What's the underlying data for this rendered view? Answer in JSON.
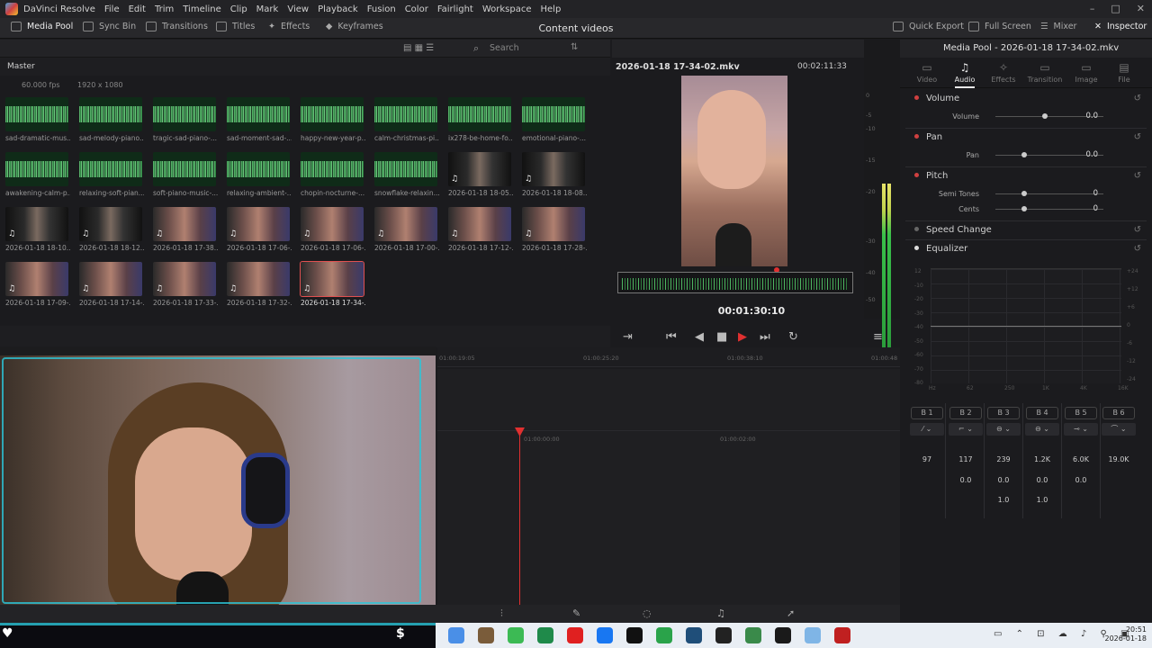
{
  "menubar": {
    "app": "DaVinci Resolve",
    "items": [
      "File",
      "Edit",
      "Trim",
      "Timeline",
      "Clip",
      "Mark",
      "View",
      "Playback",
      "Fusion",
      "Color",
      "Fairlight",
      "Workspace",
      "Help"
    ]
  },
  "toolbar": {
    "media_pool": "Media Pool",
    "sync_bin": "Sync Bin",
    "transitions": "Transitions",
    "titles": "Titles",
    "effects": "Effects",
    "keyframes": "Keyframes",
    "project_title": "Content videos",
    "quick_export": "Quick Export",
    "full_screen": "Full Screen",
    "mixer": "Mixer",
    "inspector": "Inspector"
  },
  "media_pool": {
    "search_placeholder": "Search",
    "bin": "Master",
    "fps": "60.000 fps",
    "resolution": "1920 x 1080",
    "clips": [
      {
        "label": "sad-dramatic-mus...",
        "kind": "audio"
      },
      {
        "label": "sad-melody-piano...",
        "kind": "audio"
      },
      {
        "label": "tragic-sad-piano-...",
        "kind": "audio"
      },
      {
        "label": "sad-moment-sad-...",
        "kind": "audio"
      },
      {
        "label": "happy-new-year-p...",
        "kind": "audio"
      },
      {
        "label": "calm-christmas-pi...",
        "kind": "audio"
      },
      {
        "label": "ix278-be-home-fo...",
        "kind": "audio"
      },
      {
        "label": "emotional-piano-...",
        "kind": "audio"
      },
      {
        "label": "awakening-calm-p...",
        "kind": "audio"
      },
      {
        "label": "relaxing-soft-pian...",
        "kind": "audio"
      },
      {
        "label": "soft-piano-music-...",
        "kind": "audio"
      },
      {
        "label": "relaxing-ambient-...",
        "kind": "audio"
      },
      {
        "label": "chopin-nocturne-...",
        "kind": "audio"
      },
      {
        "label": "snowflake-relaxin...",
        "kind": "audio"
      },
      {
        "label": "2026-01-18 18-05...",
        "kind": "dark"
      },
      {
        "label": "2026-01-18 18-08...",
        "kind": "dark"
      },
      {
        "label": "2026-01-18 18-10...",
        "kind": "dark"
      },
      {
        "label": "2026-01-18 18-12...",
        "kind": "dark"
      },
      {
        "label": "2026-01-18 17-38...",
        "kind": "video"
      },
      {
        "label": "2026-01-18 17-06-...",
        "kind": "video"
      },
      {
        "label": "2026-01-18 17-06-...",
        "kind": "video"
      },
      {
        "label": "2026-01-18 17-00-...",
        "kind": "video"
      },
      {
        "label": "2026-01-18 17-12-...",
        "kind": "video"
      },
      {
        "label": "2026-01-18 17-28-...",
        "kind": "video"
      },
      {
        "label": "2026-01-18 17-09-...",
        "kind": "video"
      },
      {
        "label": "2026-01-18 17-14-...",
        "kind": "video"
      },
      {
        "label": "2026-01-18 17-33-...",
        "kind": "video"
      },
      {
        "label": "2026-01-18 17-32-...",
        "kind": "video"
      },
      {
        "label": "2026-01-18 17-34-...",
        "kind": "video",
        "selected": true
      }
    ]
  },
  "viewer": {
    "file": "2026-01-18 17-34-02.mkv",
    "duration": "00:02:11:33",
    "timecode": "00:01:30:10"
  },
  "meter_labels": [
    "0",
    "-5",
    "-10",
    "-15",
    "-20",
    "-30",
    "-40",
    "-50"
  ],
  "inspector": {
    "title": "Media Pool - 2026-01-18 17-34-02.mkv",
    "tabs": [
      "Video",
      "Audio",
      "Effects",
      "Transition",
      "Image",
      "File"
    ],
    "active_tab": "Audio",
    "volume": {
      "title": "Volume",
      "label": "Volume",
      "value": "0.0"
    },
    "pan": {
      "title": "Pan",
      "label": "Pan",
      "value": "0.0"
    },
    "pitch": {
      "title": "Pitch",
      "semitones_label": "Semi Tones",
      "semitones": "0",
      "cents_label": "Cents",
      "cents": "0"
    },
    "speed_change": "Speed Change",
    "equalizer": "Equalizer",
    "eq_db_labels": [
      "+24",
      "+12",
      "+6",
      "0",
      "-6",
      "-12",
      "-24"
    ],
    "eq_db_labels_left": [
      "12",
      "-10",
      "-20",
      "-30",
      "-40",
      "-50",
      "-60",
      "-70",
      "-80"
    ],
    "eq_freq_labels": [
      "Hz",
      "62",
      "250",
      "1K",
      "4K",
      "16K"
    ],
    "bands": [
      "B 1",
      "B 2",
      "B 3",
      "B 4",
      "B 5",
      "B 6"
    ],
    "band_freqs": [
      "97",
      "117",
      "239",
      "1.2K",
      "6.0K",
      "19.0K"
    ],
    "band_gains": [
      "0.0",
      "0.0",
      "0.0",
      "0.0"
    ],
    "band_q": [
      "1.0",
      "1.0"
    ]
  },
  "timeline": {
    "ruler_marks": [
      "01:00:19:05",
      "01:00:25:20",
      "01:00:38:10",
      "01:00:48"
    ],
    "ruler2_marks": [
      "01:00:00:00",
      "01:00:02:00"
    ]
  },
  "taskbar": {
    "time": "20:51",
    "date": "2026-01-18",
    "icon_colors": [
      "#4a8fe7",
      "#7a5c3a",
      "#3cba54",
      "#1f8a4a",
      "#e02020",
      "#1877f2",
      "#111111",
      "#2aa34a",
      "#1f4e79",
      "#222222",
      "#3a8a4a",
      "#1a1a1a",
      "#7fb5e6",
      "#c02020"
    ]
  },
  "stream_overlay": {
    "money_symbol": "$"
  }
}
